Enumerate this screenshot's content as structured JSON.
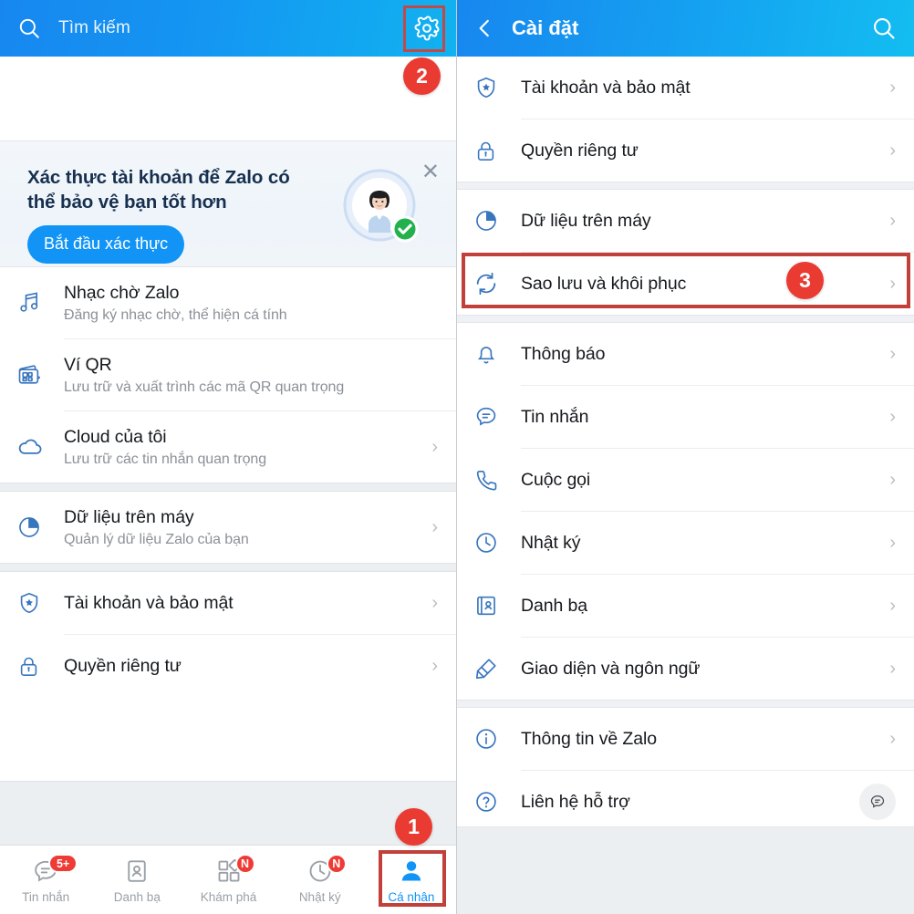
{
  "left": {
    "appbar": {
      "search_placeholder": "Tìm kiếm",
      "search_icon": "search-icon",
      "gear_icon": "gear-icon"
    },
    "verify_card": {
      "title": "Xác thực tài khoản để Zalo có thể bảo vệ bạn tốt hơn",
      "button": "Bắt đầu xác thực",
      "close_icon": "close-icon"
    },
    "items": [
      {
        "title": "Nhạc chờ Zalo",
        "sub": "Đăng ký nhạc chờ, thể hiện cá tính",
        "icon": "music-note-icon",
        "chevron": false
      },
      {
        "title": "Ví QR",
        "sub": "Lưu trữ và xuất trình các mã QR quan trọng",
        "icon": "qr-wallet-icon",
        "chevron": false
      },
      {
        "title": "Cloud của tôi",
        "sub": "Lưu trữ các tin nhắn quan trọng",
        "icon": "cloud-icon",
        "chevron": true
      },
      {
        "title": "Dữ liệu trên máy",
        "sub": "Quản lý dữ liệu Zalo của bạn",
        "icon": "pie-chart-icon",
        "chevron": true
      },
      {
        "title": "Tài khoản và bảo mật",
        "sub": "",
        "icon": "shield-star-icon",
        "chevron": true
      },
      {
        "title": "Quyền riêng tư",
        "sub": "",
        "icon": "lock-icon",
        "chevron": true
      }
    ],
    "bottom_nav": [
      {
        "label": "Tin nhắn",
        "icon": "chat-bubble-icon",
        "badge": "5+",
        "active": false
      },
      {
        "label": "Danh bạ",
        "icon": "contacts-icon",
        "badge": "",
        "active": false
      },
      {
        "label": "Khám phá",
        "icon": "discover-grid-icon",
        "badge": "N",
        "active": false
      },
      {
        "label": "Nhật ký",
        "icon": "clock-icon",
        "badge": "N",
        "active": false
      },
      {
        "label": "Cá nhân",
        "icon": "person-icon",
        "badge": "",
        "active": true
      }
    ]
  },
  "right": {
    "appbar": {
      "title": "Cài đặt",
      "back_icon": "chevron-left-icon",
      "search_icon": "search-icon"
    },
    "items": [
      {
        "title": "Tài khoản và bảo mật",
        "icon": "shield-star-icon",
        "gap_after": false
      },
      {
        "title": "Quyền riêng tư",
        "icon": "lock-icon",
        "gap_after": true
      },
      {
        "title": "Dữ liệu trên máy",
        "icon": "pie-chart-icon",
        "gap_after": false
      },
      {
        "title": "Sao lưu và khôi phục",
        "icon": "sync-refresh-icon",
        "gap_after": true
      },
      {
        "title": "Thông báo",
        "icon": "bell-icon",
        "gap_after": false
      },
      {
        "title": "Tin nhắn",
        "icon": "chat-bubble-icon",
        "gap_after": false
      },
      {
        "title": "Cuộc gọi",
        "icon": "phone-icon",
        "gap_after": false
      },
      {
        "title": "Nhật ký",
        "icon": "clock-icon",
        "gap_after": false
      },
      {
        "title": "Danh bạ",
        "icon": "contacts-book-icon",
        "gap_after": false
      },
      {
        "title": "Giao diện và ngôn ngữ",
        "icon": "paint-brush-icon",
        "gap_after": true
      },
      {
        "title": "Thông tin về Zalo",
        "icon": "info-circle-icon",
        "gap_after": false
      },
      {
        "title": "Liên hệ hỗ trợ",
        "icon": "question-circle-icon",
        "gap_after": false
      }
    ]
  },
  "steps": [
    {
      "number": "1",
      "target": "bottom-nav-ca-nhan"
    },
    {
      "number": "2",
      "target": "settings-gear-button"
    },
    {
      "number": "3",
      "target": "sao-luu-va-khoi-phuc-row"
    }
  ],
  "colors": {
    "brand_blue": "#1294f6",
    "header_gradient_start": "#1787ef",
    "header_gradient_end": "#11b2f0",
    "badge_red": "#ea3b33",
    "highlight_border": "#bf4a4a",
    "icon_blue": "#2f6fb5",
    "text_primary": "#16191d",
    "text_secondary": "#8c9198"
  }
}
